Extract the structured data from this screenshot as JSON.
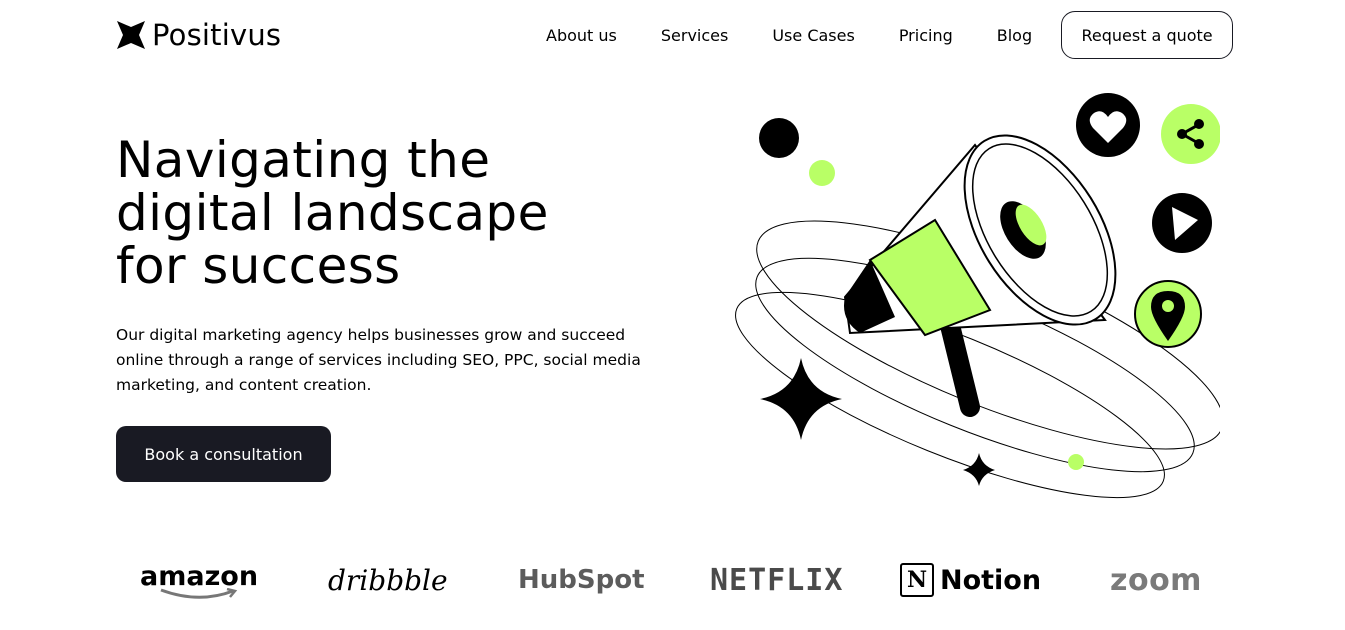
{
  "header": {
    "brand": "Positivus",
    "nav": [
      "About us",
      "Services",
      "Use Cases",
      "Pricing",
      "Blog"
    ],
    "quote_button": "Request a quote"
  },
  "hero": {
    "title": "Navigating the\ndigital landscape\nfor success",
    "description": "Our digital marketing agency helps businesses grow and succeed online through a range of services including SEO, PPC, social media marketing, and content creation.",
    "cta": "Book a consultation"
  },
  "clients": {
    "amazon": "amazon",
    "dribbble": "dribbble",
    "hubspot": "HubSpot",
    "netflix": "NETFLIX",
    "notion": "Notion",
    "notion_mark": "N",
    "zoom": "zoom"
  },
  "colors": {
    "accent": "#B9FF66",
    "dark": "#191A23",
    "text": "#000000",
    "background": "#FFFFFF"
  },
  "icons": [
    "logo-star-icon",
    "heart-icon",
    "share-icon",
    "play-icon",
    "location-pin-icon",
    "megaphone-icon",
    "sparkle-star-icon"
  ]
}
